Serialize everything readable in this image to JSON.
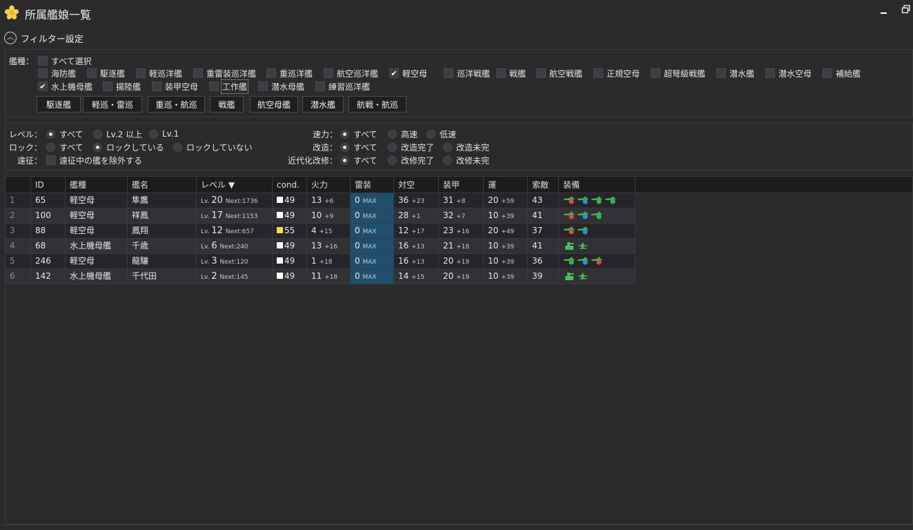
{
  "title": "所属艦娘一覧",
  "filter_toggle_label": "フィルター設定",
  "types_label": "艦種：",
  "select_all": "すべて選択",
  "ship_types": [
    {
      "label": "海防艦",
      "checked": false
    },
    {
      "label": "駆逐艦",
      "checked": false
    },
    {
      "label": "軽巡洋艦",
      "checked": false
    },
    {
      "label": "重雷装巡洋艦",
      "checked": false
    },
    {
      "label": "重巡洋艦",
      "checked": false
    },
    {
      "label": "航空巡洋艦",
      "checked": false
    },
    {
      "label": "軽空母",
      "checked": true
    },
    {
      "label": "巡洋戦艦",
      "checked": false
    },
    {
      "label": "戦艦",
      "checked": false
    },
    {
      "label": "航空戦艦",
      "checked": false
    },
    {
      "label": "正規空母",
      "checked": false
    },
    {
      "label": "超弩級戦艦",
      "checked": false
    },
    {
      "label": "潜水艦",
      "checked": false
    },
    {
      "label": "潜水空母",
      "checked": false
    },
    {
      "label": "補給艦",
      "checked": false
    },
    {
      "label": "水上機母艦",
      "checked": true
    },
    {
      "label": "揚陸艦",
      "checked": false
    },
    {
      "label": "装甲空母",
      "checked": false
    },
    {
      "label": "工作艦",
      "checked": false
    },
    {
      "label": "潜水母艦",
      "checked": false
    },
    {
      "label": "練習巡洋艦",
      "checked": false
    }
  ],
  "quick_buttons": [
    "駆逐艦",
    "軽巡・雷巡",
    "重巡・航巡",
    "戦艦",
    "航空母艦",
    "潜水艦",
    "航戦・航巡"
  ],
  "options": {
    "level_label": "レベル：",
    "level_opts": [
      "すべて",
      "Lv.2 以上",
      "Lv.1"
    ],
    "lock_label": "ロック：",
    "lock_opts": [
      "すべて",
      "ロックしている",
      "ロックしていない"
    ],
    "expedition_label": "遠征：",
    "expedition_opt": "遠征中の艦を除外する",
    "speed_label": "速力：",
    "speed_opts": [
      "すべて",
      "高速",
      "低速"
    ],
    "remodel_label": "改造：",
    "remodel_opts": [
      "すべて",
      "改造完了",
      "改造未完"
    ],
    "modern_label": "近代化改修：",
    "modern_opts": [
      "すべて",
      "改修完了",
      "改修未完"
    ]
  },
  "columns": [
    "",
    "ID",
    "艦種",
    "艦名",
    "レベル ▼",
    "cond.",
    "火力",
    "雷装",
    "対空",
    "装甲",
    "運",
    "索敵",
    "装備"
  ],
  "rows": [
    {
      "num": "1",
      "id": "65",
      "type": "軽空母",
      "name": "隼鷹",
      "lv": "20",
      "next": "Next:1736",
      "cond": "49",
      "cond_color": "#ffffff",
      "fire": "13",
      "fire_p": "+6",
      "torp": "0",
      "torp_p": "MAX",
      "aa": "36",
      "aa_p": "+23",
      "armor": "31",
      "armor_p": "+8",
      "luck": "20",
      "luck_p": "+59",
      "los": "43",
      "equip": [
        "fighter-red",
        "bomber-blue",
        "fighter-green",
        "fighter-green"
      ]
    },
    {
      "num": "2",
      "id": "100",
      "type": "軽空母",
      "name": "祥鳳",
      "lv": "17",
      "next": "Next:1153",
      "cond": "49",
      "cond_color": "#ffffff",
      "fire": "10",
      "fire_p": "+9",
      "torp": "0",
      "torp_p": "MAX",
      "aa": "28",
      "aa_p": "+1",
      "armor": "32",
      "armor_p": "+7",
      "luck": "10",
      "luck_p": "+39",
      "los": "41",
      "equip": [
        "fighter-red",
        "bomber-blue",
        "fighter-green"
      ]
    },
    {
      "num": "3",
      "id": "88",
      "type": "軽空母",
      "name": "鳳翔",
      "lv": "12",
      "next": "Next:657",
      "cond": "55",
      "cond_color": "#f0e040",
      "fire": "4",
      "fire_p": "+15",
      "torp": "0",
      "torp_p": "MAX",
      "aa": "12",
      "aa_p": "+17",
      "armor": "23",
      "armor_p": "+16",
      "luck": "20",
      "luck_p": "+49",
      "los": "37",
      "equip": [
        "fighter-red",
        "bomber-blue"
      ]
    },
    {
      "num": "4",
      "id": "68",
      "type": "水上機母艦",
      "name": "千歳",
      "lv": "6",
      "next": "Next:240",
      "cond": "49",
      "cond_color": "#ffffff",
      "fire": "13",
      "fire_p": "+16",
      "torp": "0",
      "torp_p": "MAX",
      "aa": "16",
      "aa_p": "+13",
      "armor": "21",
      "armor_p": "+18",
      "luck": "10",
      "luck_p": "+39",
      "los": "41",
      "equip": [
        "gun-green",
        "seaplane-green"
      ]
    },
    {
      "num": "5",
      "id": "246",
      "type": "軽空母",
      "name": "龍驤",
      "lv": "3",
      "next": "Next:120",
      "cond": "49",
      "cond_color": "#ffffff",
      "fire": "1",
      "fire_p": "+18",
      "torp": "0",
      "torp_p": "MAX",
      "aa": "16",
      "aa_p": "+13",
      "armor": "20",
      "armor_p": "+19",
      "luck": "10",
      "luck_p": "+39",
      "los": "36",
      "equip": [
        "fighter-green",
        "bomber-blue",
        "fighter-red"
      ]
    },
    {
      "num": "6",
      "id": "142",
      "type": "水上機母艦",
      "name": "千代田",
      "lv": "2",
      "next": "Next:145",
      "cond": "49",
      "cond_color": "#ffffff",
      "fire": "11",
      "fire_p": "+18",
      "torp": "0",
      "torp_p": "MAX",
      "aa": "14",
      "aa_p": "+15",
      "armor": "20",
      "armor_p": "+19",
      "luck": "10",
      "luck_p": "+39",
      "los": "39",
      "equip": [
        "gun-green",
        "seaplane-green"
      ]
    }
  ]
}
